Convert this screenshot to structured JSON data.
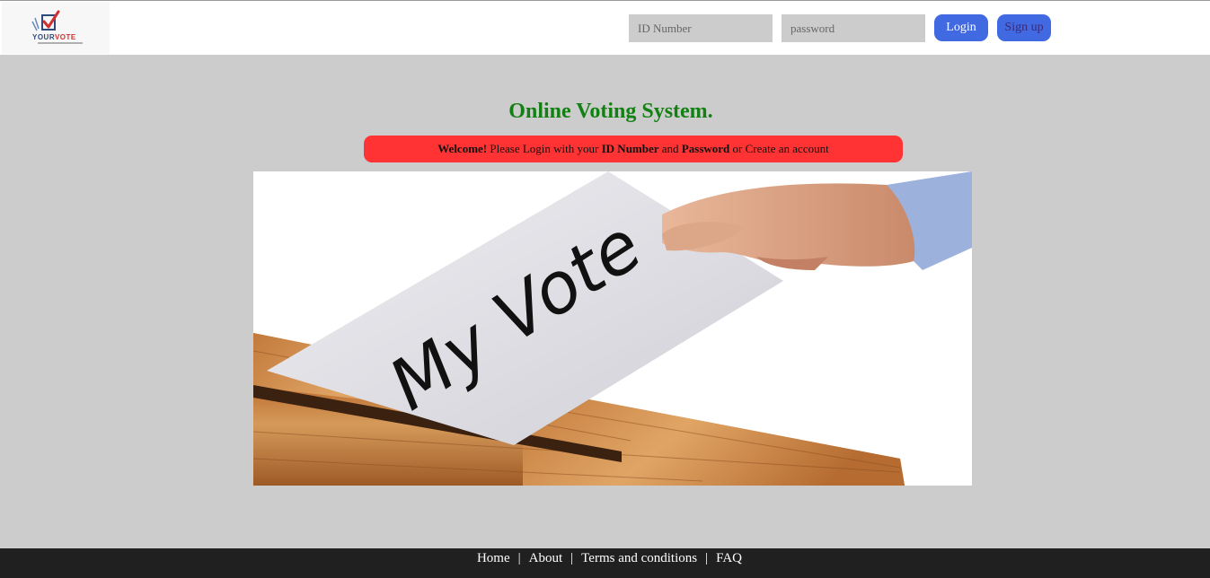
{
  "brand": {
    "logo_text_a": "YOUR",
    "logo_text_b": "VOTE"
  },
  "login": {
    "id_placeholder": "ID Number",
    "password_placeholder": "password",
    "login_label": "Login",
    "signup_label": "Sign up"
  },
  "main": {
    "title": "Online Voting System.",
    "welcome": {
      "strong1": "Welcome!",
      "text1": " Please Login with your ",
      "strong2": "ID Number",
      "text2": " and ",
      "strong3": "Password",
      "text3": " or Create an account"
    },
    "hero_ballot_text": "My Vote"
  },
  "footer": {
    "links": [
      "Home",
      "About",
      "Terms and conditions",
      "FAQ"
    ],
    "separator": "|"
  },
  "colors": {
    "title": "#138013",
    "welcome_bg": "#ff3333",
    "button_bg": "#4169e1",
    "page_bg": "#cccccc",
    "footer_bg": "#202020"
  }
}
